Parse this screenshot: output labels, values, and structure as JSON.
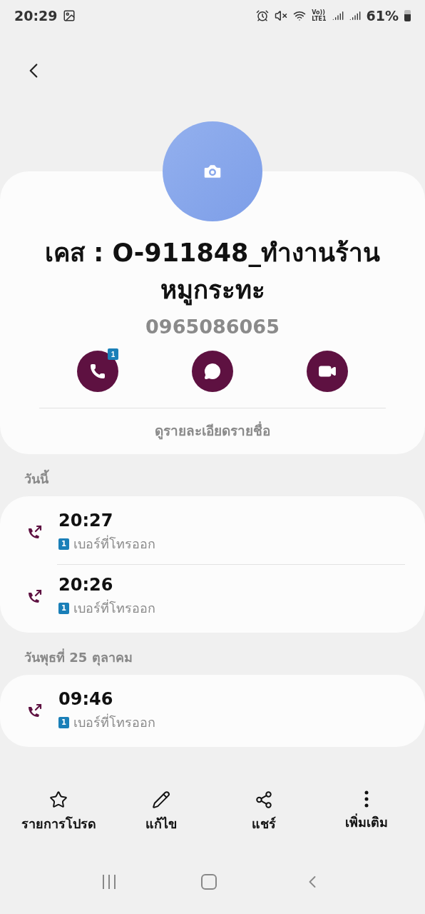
{
  "status_bar": {
    "time": "20:29",
    "volte": [
      "Vo))",
      "LTE1"
    ],
    "battery": "61%"
  },
  "contact": {
    "name": "เคส : O-911848_ทำงานร้านหมูกระทะ",
    "phone": "0965086065",
    "actions": [
      {
        "kind": "call",
        "badge": "1"
      },
      {
        "kind": "message"
      },
      {
        "kind": "video"
      }
    ],
    "details_link": "ดูรายละเอียดรายชื่อ"
  },
  "call_groups": [
    {
      "date": "วันนี้",
      "calls": [
        {
          "kind": "outgoing",
          "time": "20:27",
          "sim": "1",
          "type": "เบอร์ที่โทรออก"
        },
        {
          "kind": "outgoing",
          "time": "20:26",
          "sim": "1",
          "type": "เบอร์ที่โทรออก"
        }
      ]
    },
    {
      "date": "วันพุธที่ 25 ตุลาคม",
      "calls": [
        {
          "kind": "outgoing",
          "time": "09:46",
          "sim": "1",
          "type": "เบอร์ที่โทรออก"
        }
      ]
    }
  ],
  "bottom_actions": [
    {
      "kind": "favorite",
      "label": "รายการโปรด"
    },
    {
      "kind": "edit",
      "label": "แก้ไข"
    },
    {
      "kind": "share",
      "label": "แชร์"
    },
    {
      "kind": "more",
      "label": "เพิ่มเติม"
    }
  ]
}
